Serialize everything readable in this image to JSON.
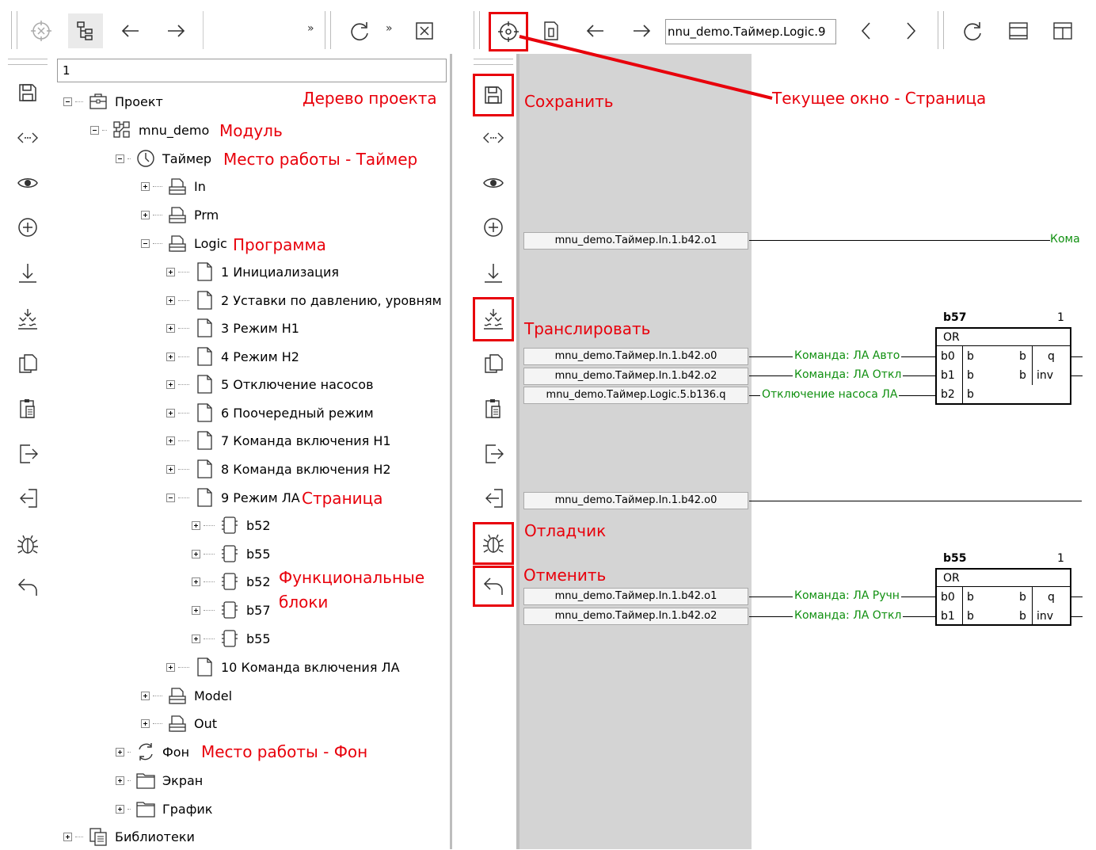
{
  "left_toolbar": {
    "more1": "»",
    "more2": "»"
  },
  "search": {
    "value": "1"
  },
  "tree": {
    "nodes": [
      {
        "label": "Проект"
      },
      {
        "label": "mnu_demo"
      },
      {
        "label": "Таймер"
      },
      {
        "label": "In"
      },
      {
        "label": "Prm"
      },
      {
        "label": "Logic"
      },
      {
        "label": "1 Инициализация"
      },
      {
        "label": "2 Уставки по давлению, уровням"
      },
      {
        "label": "3 Режим Н1"
      },
      {
        "label": "4 Режим Н2"
      },
      {
        "label": "5 Отключение насосов"
      },
      {
        "label": "6 Поочередный режим"
      },
      {
        "label": "7 Команда включения Н1"
      },
      {
        "label": "8 Команда включения Н2"
      },
      {
        "label": "9 Режим ЛА"
      },
      {
        "label": "b52"
      },
      {
        "label": "b55"
      },
      {
        "label": "b52"
      },
      {
        "label": "b57"
      },
      {
        "label": "b55"
      },
      {
        "label": "10 Команда включения ЛА"
      },
      {
        "label": "Model"
      },
      {
        "label": "Out"
      },
      {
        "label": "Фон"
      },
      {
        "label": "Экран"
      },
      {
        "label": "График"
      },
      {
        "label": "Библиотеки"
      }
    ]
  },
  "right_toolbar": {
    "path": "nnu_demo.Таймер.Logic.9"
  },
  "annotations": {
    "tree": "Дерево проекта",
    "module": "Модуль",
    "timer": "Место работы - Таймер",
    "program": "Программа",
    "page": "Страница",
    "fblocks_1": "Функциональные",
    "fblocks_2": "блоки",
    "background": "Место работы - Фон",
    "save": "Сохранить",
    "translate": "Транслировать",
    "debugger": "Отладчик",
    "undo": "Отменить",
    "current": "Текущее окно - Страница"
  },
  "canvas": {
    "signals": [
      "mnu_demo.Таймер.In.1.b42.o1",
      "mnu_demo.Таймер.In.1.b42.o0",
      "mnu_demo.Таймер.In.1.b42.o2",
      "mnu_demo.Таймер.Logic.5.b136.q",
      "mnu_demo.Таймер.In.1.b42.o0",
      "mnu_demo.Таймер.In.1.b42.o1",
      "mnu_demo.Таймер.In.1.b42.o2"
    ],
    "wire_labels": [
      "Кома",
      "Команда: ЛА Авто",
      "Команда: ЛА Откл",
      "Отключение насоса ЛА",
      "Команда: ЛА Ручн",
      "Команда: ЛА Откл"
    ],
    "blocks": [
      {
        "name": "b57",
        "num": "1",
        "type": "OR",
        "inputs": [
          [
            "b0",
            "b"
          ],
          [
            "b1",
            "b"
          ],
          [
            "b2",
            "b"
          ]
        ],
        "outputs": [
          [
            "b",
            "q"
          ],
          [
            "b",
            "inv"
          ]
        ]
      },
      {
        "name": "b55",
        "num": "1",
        "type": "OR",
        "inputs": [
          [
            "b0",
            "b"
          ],
          [
            "b1",
            "b"
          ]
        ],
        "outputs": [
          [
            "b",
            "q"
          ],
          [
            "b",
            "inv"
          ]
        ]
      }
    ]
  },
  "colors": {
    "annotation": "#e8000b",
    "wire_label": "#109010",
    "grey_panel": "#d4d4d4"
  }
}
